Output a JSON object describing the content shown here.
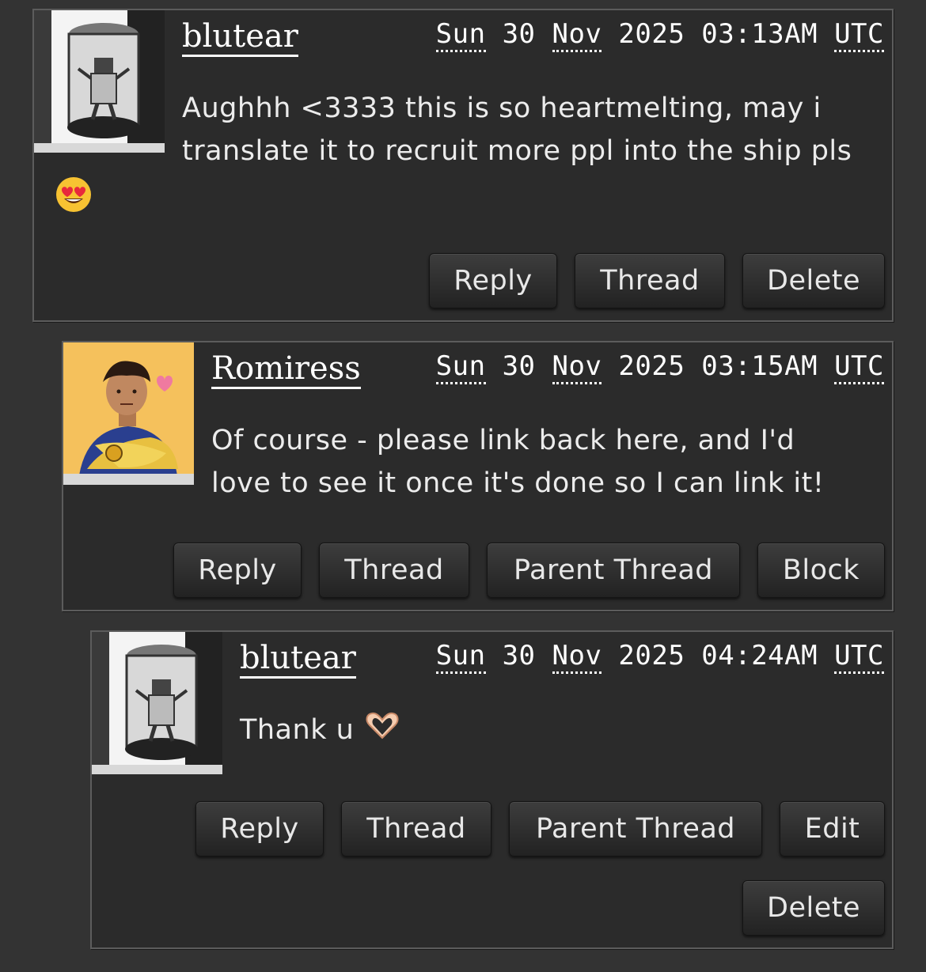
{
  "comments": [
    {
      "username": "blutear",
      "date": {
        "day": "Sun",
        "d": "30",
        "month": "Nov",
        "year": "2025",
        "time": "03:13AM",
        "tz": "UTC"
      },
      "body_line1": "Aughhh <3333 this is so heartmelting, may i",
      "body_line2": "translate it to recruit more ppl into the ship pls",
      "emoji": "heart-eyes-emoji",
      "buttons": {
        "reply": "Reply",
        "thread": "Thread",
        "delete": "Delete"
      }
    },
    {
      "username": "Romiress",
      "date": {
        "day": "Sun",
        "d": "30",
        "month": "Nov",
        "year": "2025",
        "time": "03:15AM",
        "tz": "UTC"
      },
      "body_line1": "Of course - please link back here, and I'd",
      "body_line2": "love to see it once it's done so I can link it!",
      "buttons": {
        "reply": "Reply",
        "thread": "Thread",
        "parent": "Parent Thread",
        "block": "Block"
      }
    },
    {
      "username": "blutear",
      "date": {
        "day": "Sun",
        "d": "30",
        "month": "Nov",
        "year": "2025",
        "time": "04:24AM",
        "tz": "UTC"
      },
      "body": "Thank u",
      "emoji": "heart-hands-emoji",
      "buttons": {
        "reply": "Reply",
        "thread": "Thread",
        "parent": "Parent Thread",
        "edit": "Edit",
        "delete": "Delete"
      }
    }
  ],
  "colors": {
    "background": "#333333",
    "panel": "#2b2b2b",
    "text": "#e6e6e6",
    "romiress_avatar_bg": "#f5c15c"
  }
}
